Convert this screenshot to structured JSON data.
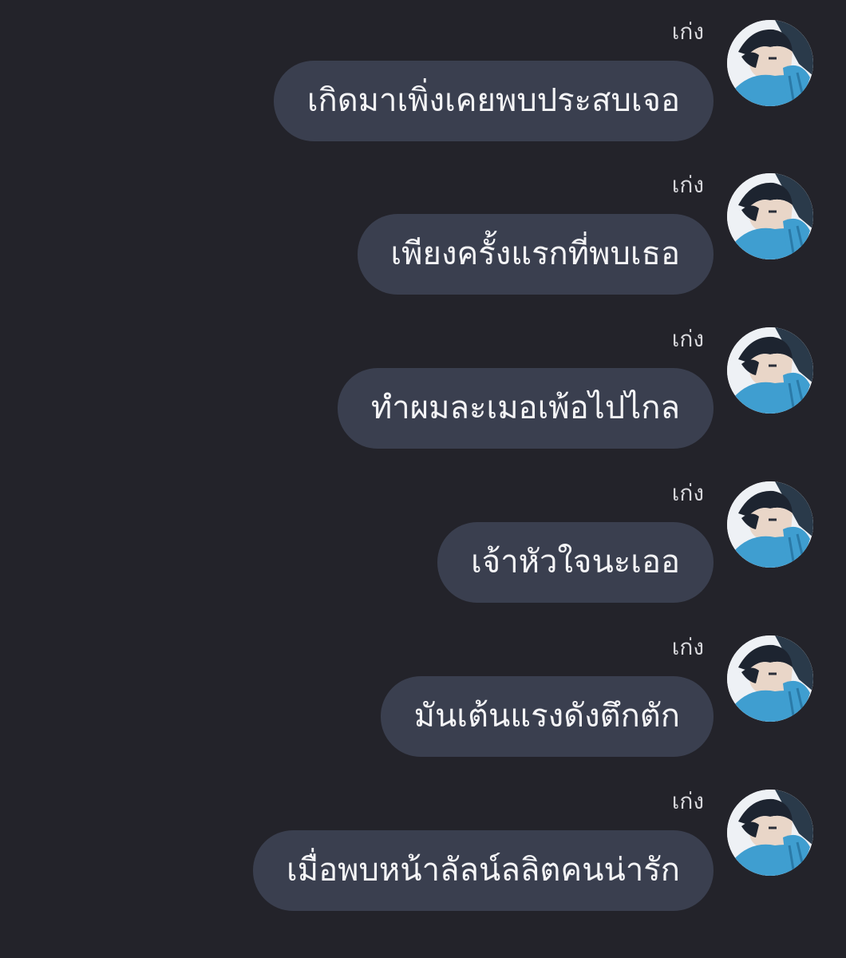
{
  "sender_name": "เก่ง",
  "avatar_icon": "anime-boy-blue-scarf-avatar",
  "colors": {
    "background": "#23232a",
    "bubble": "#3a3f4f",
    "text": "#f4f4f6",
    "sender": "#d8d8dc",
    "scarf": "#3f9ed0"
  },
  "messages": [
    {
      "sender": "เก่ง",
      "text": "เกิดมาเพิ่งเคยพบประสบเจอ"
    },
    {
      "sender": "เก่ง",
      "text": "เพียงครั้งแรกที่พบเธอ"
    },
    {
      "sender": "เก่ง",
      "text": "ทำผมละเมอเพ้อไปไกล"
    },
    {
      "sender": "เก่ง",
      "text": "เจ้าหัวใจนะเออ"
    },
    {
      "sender": "เก่ง",
      "text": "มันเต้นแรงดังตึกตัก"
    },
    {
      "sender": "เก่ง",
      "text": "เมื่อพบหน้าลัลน์ลลิตคนน่ารัก"
    }
  ]
}
